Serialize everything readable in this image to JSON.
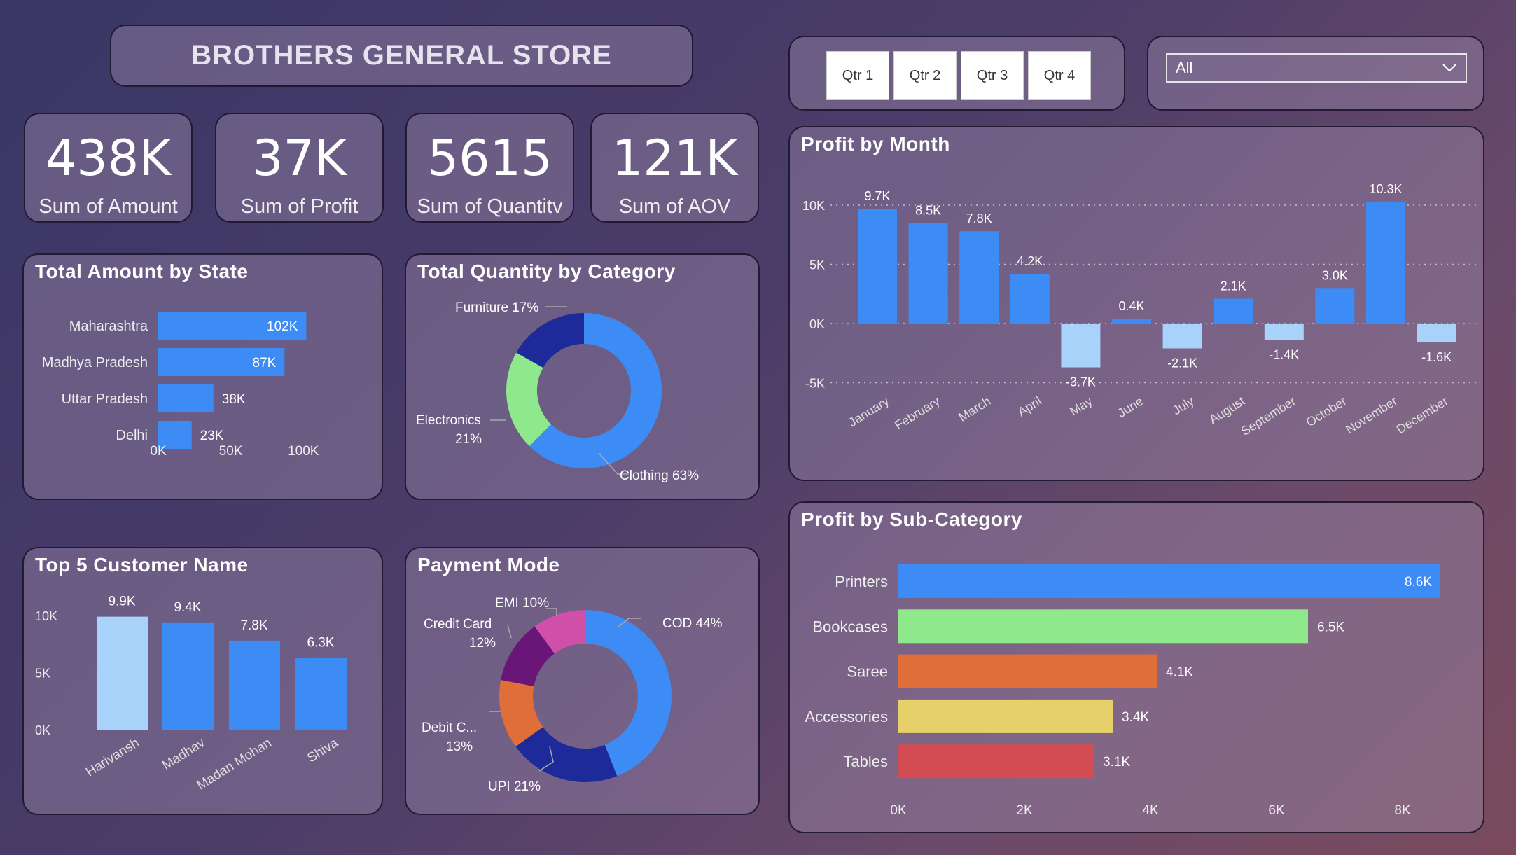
{
  "title": "BROTHERS GENERAL STORE",
  "kpis": [
    {
      "value": "438K",
      "label": "Sum of Amount"
    },
    {
      "value": "37K",
      "label": "Sum of Profit"
    },
    {
      "value": "5615",
      "label": "Sum of Quantitv"
    },
    {
      "value": "121K",
      "label": "Sum of AOV"
    }
  ],
  "filters": {
    "quarters": [
      "Qtr 1",
      "Qtr 2",
      "Qtr 3",
      "Qtr 4"
    ],
    "dropdown_value": "All",
    "dropdown_icon": "chevron-down-icon"
  },
  "colors": {
    "blue": "#3d8bf5",
    "light_blue": "#a9d2fb",
    "navy": "#1e2a9a",
    "green": "#8fe88b",
    "orange": "#e06e38",
    "yellow": "#e6d06a",
    "red": "#d24c52",
    "purple": "#6a1678",
    "pink": "#d04fa8"
  },
  "chart_data": [
    {
      "id": "state",
      "type": "bar",
      "orientation": "horizontal",
      "title": "Total Amount by State",
      "categories": [
        "Maharashtra",
        "Madhya Pradesh",
        "Uttar Pradesh",
        "Delhi"
      ],
      "values": [
        102,
        87,
        38,
        23
      ],
      "value_labels": [
        "102K",
        "87K",
        "38K",
        "23K"
      ],
      "xticks": [
        "0K",
        "50K",
        "100K"
      ],
      "xtick_values": [
        0,
        50,
        100
      ],
      "xlim": [
        0,
        110
      ],
      "color": "#3d8bf5"
    },
    {
      "id": "category",
      "type": "pie",
      "donut": true,
      "title": "Total Quantity by Category",
      "slices": [
        {
          "label": "Clothing 63%",
          "value": 63,
          "color": "#3d8bf5"
        },
        {
          "label": "Electronics 21%",
          "value": 21,
          "color": "#8fe88b"
        },
        {
          "label": "Furniture 17%",
          "value": 17,
          "color": "#1e2a9a"
        }
      ]
    },
    {
      "id": "customers",
      "type": "bar",
      "title": "Top 5 Customer Name",
      "categories": [
        "Harivansh",
        "Madhav",
        "Madan Mohan",
        "Shiva"
      ],
      "values": [
        9.9,
        9.4,
        7.8,
        6.3
      ],
      "value_labels": [
        "9.9K",
        "9.4K",
        "7.8K",
        "6.3K"
      ],
      "colors": [
        "#a9d2fb",
        "#3d8bf5",
        "#3d8bf5",
        "#3d8bf5"
      ],
      "yticks": [
        "10K",
        "5K",
        "0K"
      ],
      "ytick_values": [
        10,
        5,
        0
      ],
      "ylim": [
        0,
        10
      ]
    },
    {
      "id": "payment",
      "type": "pie",
      "donut": true,
      "title": "Payment Mode",
      "slices": [
        {
          "label": "COD 44%",
          "value": 44,
          "color": "#3d8bf5"
        },
        {
          "label": "UPI 21%",
          "value": 21,
          "color": "#1e2a9a"
        },
        {
          "label": "Debit C... 13%",
          "value": 13,
          "color": "#e06e38"
        },
        {
          "label": "Credit Card 12%",
          "value": 12,
          "color": "#6a1678"
        },
        {
          "label": "EMI 10%",
          "value": 10,
          "color": "#d04fa8"
        }
      ]
    },
    {
      "id": "month",
      "type": "bar",
      "title": "Profit by Month",
      "categories": [
        "January",
        "February",
        "March",
        "April",
        "May",
        "June",
        "July",
        "August",
        "September",
        "October",
        "November",
        "December"
      ],
      "values": [
        9.7,
        8.5,
        7.8,
        4.2,
        -3.7,
        0.4,
        -2.1,
        2.1,
        -1.4,
        3.0,
        10.3,
        -1.6
      ],
      "value_labels": [
        "9.7K",
        "8.5K",
        "7.8K",
        "4.2K",
        "-3.7K",
        "0.4K",
        "-2.1K",
        "2.1K",
        "-1.4K",
        "3.0K",
        "10.3K",
        "-1.6K"
      ],
      "yticks": [
        "10K",
        "5K",
        "0K",
        "-5K"
      ],
      "ytick_values": [
        10,
        5,
        0,
        -5
      ],
      "ylim": [
        -5,
        10
      ],
      "positive_color": "#3d8bf5",
      "negative_color": "#a9d2fb",
      "grid": true
    },
    {
      "id": "subcategory",
      "type": "bar",
      "orientation": "horizontal",
      "title": "Profit by Sub-Category",
      "categories": [
        "Printers",
        "Bookcases",
        "Saree",
        "Accessories",
        "Tables"
      ],
      "values": [
        8.6,
        6.5,
        4.1,
        3.4,
        3.1
      ],
      "value_labels": [
        "8.6K",
        "6.5K",
        "4.1K",
        "3.4K",
        "3.1K"
      ],
      "colors": [
        "#3d8bf5",
        "#8fe88b",
        "#e06e38",
        "#e6d06a",
        "#d24c52"
      ],
      "xticks": [
        "0K",
        "2K",
        "4K",
        "6K",
        "8K"
      ],
      "xtick_values": [
        0,
        2,
        4,
        6,
        8
      ],
      "xlim": [
        0,
        8.6
      ]
    }
  ]
}
